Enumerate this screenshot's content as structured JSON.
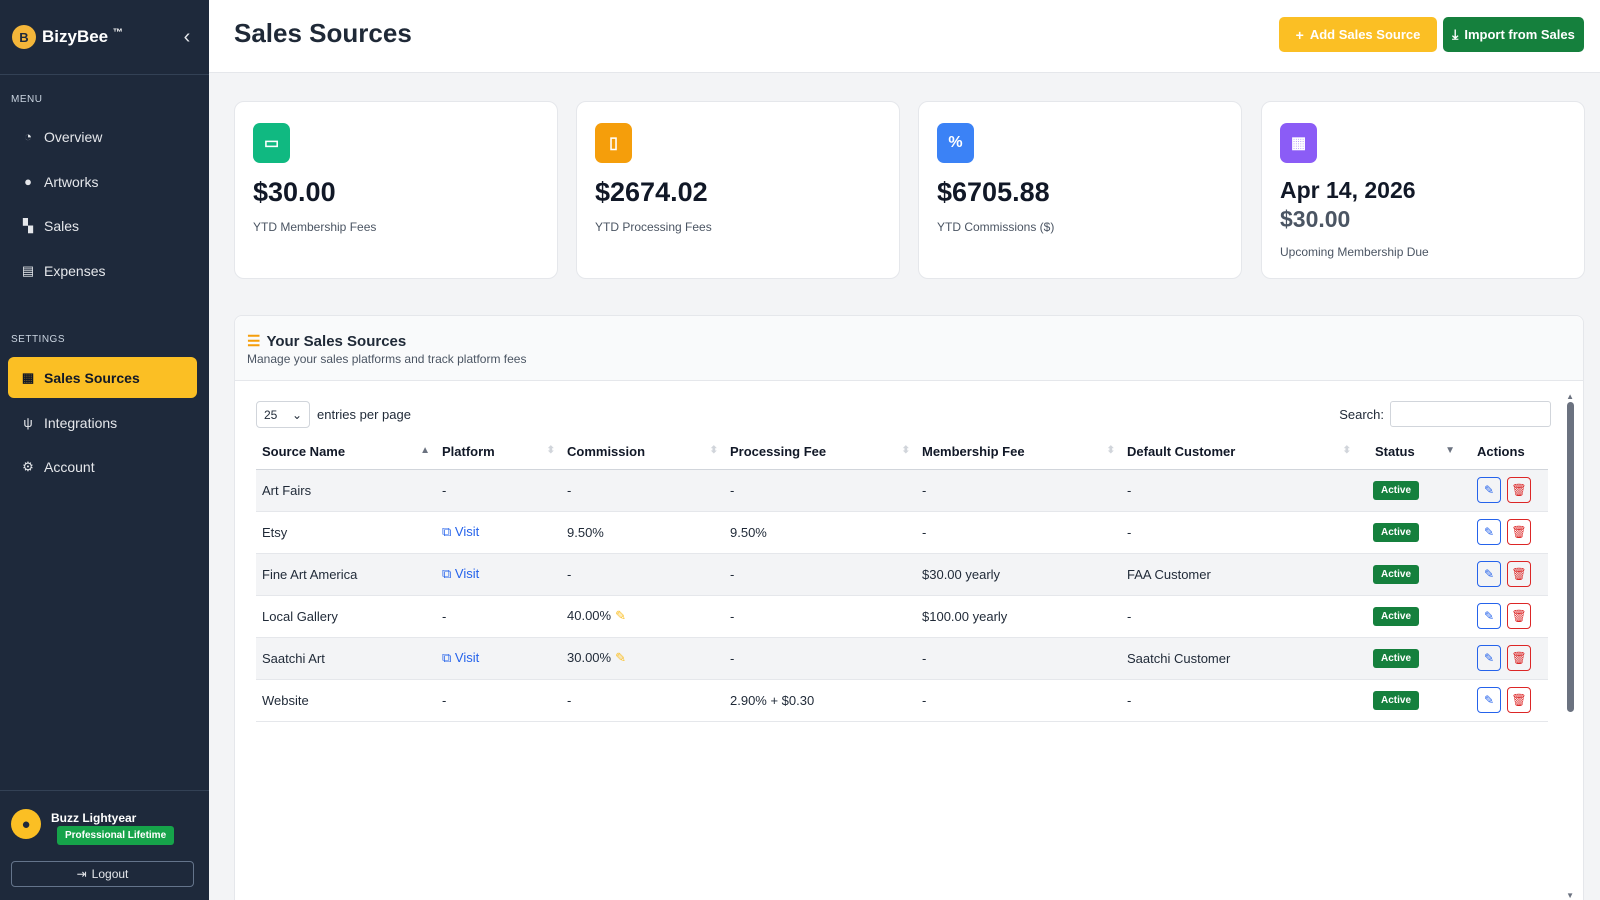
{
  "brand": {
    "name": "BizyBee",
    "tm": "™"
  },
  "sidebar": {
    "menu_label": "MENU",
    "settings_label": "SETTINGS",
    "menu": [
      {
        "label": "Overview",
        "icon": "pie-chart-icon"
      },
      {
        "label": "Artworks",
        "icon": "palette-icon"
      },
      {
        "label": "Sales",
        "icon": "cart-icon"
      },
      {
        "label": "Expenses",
        "icon": "receipt-icon"
      }
    ],
    "settings": [
      {
        "label": "Sales Sources",
        "icon": "store-icon",
        "active": true
      },
      {
        "label": "Integrations",
        "icon": "plug-icon"
      },
      {
        "label": "Account",
        "icon": "gear-icon"
      }
    ]
  },
  "user": {
    "name": "Buzz Lightyear",
    "plan": "Professional Lifetime",
    "logout": "Logout"
  },
  "header": {
    "title": "Sales Sources",
    "add_label": "Add Sales Source",
    "import_label": "Import from Sales"
  },
  "cards": [
    {
      "value": "$30.00",
      "label": "YTD Membership Fees",
      "color": "#10b981"
    },
    {
      "value": "$2674.02",
      "label": "YTD Processing Fees",
      "color": "#f59e0b"
    },
    {
      "value": "$6705.88",
      "label": "YTD Commissions ($)",
      "color": "#3b82f6"
    },
    {
      "date": "Apr 14, 2026",
      "value": "$30.00",
      "label": "Upcoming Membership Due",
      "color": "#8b5cf6"
    }
  ],
  "panel": {
    "title": "Your Sales Sources",
    "subtitle": "Manage your sales platforms and track platform fees",
    "entries_value": "25",
    "entries_label": "entries per page",
    "search_label": "Search:"
  },
  "table": {
    "columns": [
      "Source Name",
      "Platform",
      "Commission",
      "Processing Fee",
      "Membership Fee",
      "Default Customer",
      "Status",
      "Actions"
    ],
    "rows": [
      {
        "name": "Art Fairs",
        "platform": "-",
        "commission": "-",
        "processing": "-",
        "membership": "-",
        "customer": "-",
        "status": "Active"
      },
      {
        "name": "Etsy",
        "platform": "Visit",
        "commission": "9.50%",
        "processing": "9.50%",
        "membership": "-",
        "customer": "-",
        "status": "Active"
      },
      {
        "name": "Fine Art America",
        "platform": "Visit",
        "commission": "-",
        "processing": "-",
        "membership": "$30.00 yearly",
        "customer": "FAA Customer",
        "status": "Active"
      },
      {
        "name": "Local Gallery",
        "platform": "-",
        "commission": "40.00%",
        "processing": "-",
        "membership": "$100.00 yearly",
        "customer": "-",
        "status": "Active"
      },
      {
        "name": "Saatchi Art",
        "platform": "Visit",
        "commission": "30.00%",
        "processing": "-",
        "membership": "-",
        "customer": "Saatchi Customer",
        "status": "Active"
      },
      {
        "name": "Website",
        "platform": "-",
        "commission": "-",
        "processing": "2.90% + $0.30",
        "membership": "-",
        "customer": "-",
        "status": "Active"
      }
    ]
  }
}
